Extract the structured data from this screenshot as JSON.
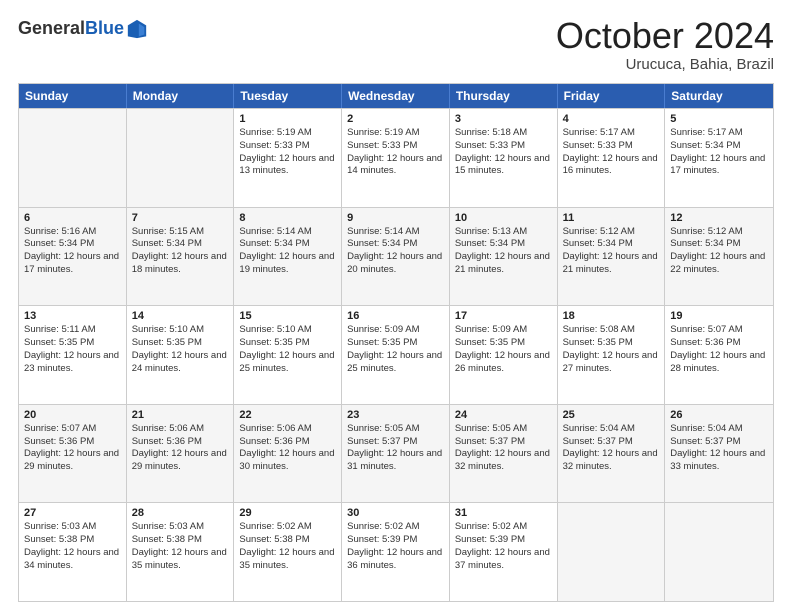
{
  "header": {
    "logo_general": "General",
    "logo_blue": "Blue",
    "month_title": "October 2024",
    "location": "Urucuca, Bahia, Brazil"
  },
  "weekdays": [
    "Sunday",
    "Monday",
    "Tuesday",
    "Wednesday",
    "Thursday",
    "Friday",
    "Saturday"
  ],
  "rows": [
    [
      {
        "day": "",
        "sunrise": "",
        "sunset": "",
        "daylight": "",
        "empty": true
      },
      {
        "day": "",
        "sunrise": "",
        "sunset": "",
        "daylight": "",
        "empty": true
      },
      {
        "day": "1",
        "sunrise": "Sunrise: 5:19 AM",
        "sunset": "Sunset: 5:33 PM",
        "daylight": "Daylight: 12 hours and 13 minutes.",
        "empty": false
      },
      {
        "day": "2",
        "sunrise": "Sunrise: 5:19 AM",
        "sunset": "Sunset: 5:33 PM",
        "daylight": "Daylight: 12 hours and 14 minutes.",
        "empty": false
      },
      {
        "day": "3",
        "sunrise": "Sunrise: 5:18 AM",
        "sunset": "Sunset: 5:33 PM",
        "daylight": "Daylight: 12 hours and 15 minutes.",
        "empty": false
      },
      {
        "day": "4",
        "sunrise": "Sunrise: 5:17 AM",
        "sunset": "Sunset: 5:33 PM",
        "daylight": "Daylight: 12 hours and 16 minutes.",
        "empty": false
      },
      {
        "day": "5",
        "sunrise": "Sunrise: 5:17 AM",
        "sunset": "Sunset: 5:34 PM",
        "daylight": "Daylight: 12 hours and 17 minutes.",
        "empty": false
      }
    ],
    [
      {
        "day": "6",
        "sunrise": "Sunrise: 5:16 AM",
        "sunset": "Sunset: 5:34 PM",
        "daylight": "Daylight: 12 hours and 17 minutes.",
        "empty": false
      },
      {
        "day": "7",
        "sunrise": "Sunrise: 5:15 AM",
        "sunset": "Sunset: 5:34 PM",
        "daylight": "Daylight: 12 hours and 18 minutes.",
        "empty": false
      },
      {
        "day": "8",
        "sunrise": "Sunrise: 5:14 AM",
        "sunset": "Sunset: 5:34 PM",
        "daylight": "Daylight: 12 hours and 19 minutes.",
        "empty": false
      },
      {
        "day": "9",
        "sunrise": "Sunrise: 5:14 AM",
        "sunset": "Sunset: 5:34 PM",
        "daylight": "Daylight: 12 hours and 20 minutes.",
        "empty": false
      },
      {
        "day": "10",
        "sunrise": "Sunrise: 5:13 AM",
        "sunset": "Sunset: 5:34 PM",
        "daylight": "Daylight: 12 hours and 21 minutes.",
        "empty": false
      },
      {
        "day": "11",
        "sunrise": "Sunrise: 5:12 AM",
        "sunset": "Sunset: 5:34 PM",
        "daylight": "Daylight: 12 hours and 21 minutes.",
        "empty": false
      },
      {
        "day": "12",
        "sunrise": "Sunrise: 5:12 AM",
        "sunset": "Sunset: 5:34 PM",
        "daylight": "Daylight: 12 hours and 22 minutes.",
        "empty": false
      }
    ],
    [
      {
        "day": "13",
        "sunrise": "Sunrise: 5:11 AM",
        "sunset": "Sunset: 5:35 PM",
        "daylight": "Daylight: 12 hours and 23 minutes.",
        "empty": false
      },
      {
        "day": "14",
        "sunrise": "Sunrise: 5:10 AM",
        "sunset": "Sunset: 5:35 PM",
        "daylight": "Daylight: 12 hours and 24 minutes.",
        "empty": false
      },
      {
        "day": "15",
        "sunrise": "Sunrise: 5:10 AM",
        "sunset": "Sunset: 5:35 PM",
        "daylight": "Daylight: 12 hours and 25 minutes.",
        "empty": false
      },
      {
        "day": "16",
        "sunrise": "Sunrise: 5:09 AM",
        "sunset": "Sunset: 5:35 PM",
        "daylight": "Daylight: 12 hours and 25 minutes.",
        "empty": false
      },
      {
        "day": "17",
        "sunrise": "Sunrise: 5:09 AM",
        "sunset": "Sunset: 5:35 PM",
        "daylight": "Daylight: 12 hours and 26 minutes.",
        "empty": false
      },
      {
        "day": "18",
        "sunrise": "Sunrise: 5:08 AM",
        "sunset": "Sunset: 5:35 PM",
        "daylight": "Daylight: 12 hours and 27 minutes.",
        "empty": false
      },
      {
        "day": "19",
        "sunrise": "Sunrise: 5:07 AM",
        "sunset": "Sunset: 5:36 PM",
        "daylight": "Daylight: 12 hours and 28 minutes.",
        "empty": false
      }
    ],
    [
      {
        "day": "20",
        "sunrise": "Sunrise: 5:07 AM",
        "sunset": "Sunset: 5:36 PM",
        "daylight": "Daylight: 12 hours and 29 minutes.",
        "empty": false
      },
      {
        "day": "21",
        "sunrise": "Sunrise: 5:06 AM",
        "sunset": "Sunset: 5:36 PM",
        "daylight": "Daylight: 12 hours and 29 minutes.",
        "empty": false
      },
      {
        "day": "22",
        "sunrise": "Sunrise: 5:06 AM",
        "sunset": "Sunset: 5:36 PM",
        "daylight": "Daylight: 12 hours and 30 minutes.",
        "empty": false
      },
      {
        "day": "23",
        "sunrise": "Sunrise: 5:05 AM",
        "sunset": "Sunset: 5:37 PM",
        "daylight": "Daylight: 12 hours and 31 minutes.",
        "empty": false
      },
      {
        "day": "24",
        "sunrise": "Sunrise: 5:05 AM",
        "sunset": "Sunset: 5:37 PM",
        "daylight": "Daylight: 12 hours and 32 minutes.",
        "empty": false
      },
      {
        "day": "25",
        "sunrise": "Sunrise: 5:04 AM",
        "sunset": "Sunset: 5:37 PM",
        "daylight": "Daylight: 12 hours and 32 minutes.",
        "empty": false
      },
      {
        "day": "26",
        "sunrise": "Sunrise: 5:04 AM",
        "sunset": "Sunset: 5:37 PM",
        "daylight": "Daylight: 12 hours and 33 minutes.",
        "empty": false
      }
    ],
    [
      {
        "day": "27",
        "sunrise": "Sunrise: 5:03 AM",
        "sunset": "Sunset: 5:38 PM",
        "daylight": "Daylight: 12 hours and 34 minutes.",
        "empty": false
      },
      {
        "day": "28",
        "sunrise": "Sunrise: 5:03 AM",
        "sunset": "Sunset: 5:38 PM",
        "daylight": "Daylight: 12 hours and 35 minutes.",
        "empty": false
      },
      {
        "day": "29",
        "sunrise": "Sunrise: 5:02 AM",
        "sunset": "Sunset: 5:38 PM",
        "daylight": "Daylight: 12 hours and 35 minutes.",
        "empty": false
      },
      {
        "day": "30",
        "sunrise": "Sunrise: 5:02 AM",
        "sunset": "Sunset: 5:39 PM",
        "daylight": "Daylight: 12 hours and 36 minutes.",
        "empty": false
      },
      {
        "day": "31",
        "sunrise": "Sunrise: 5:02 AM",
        "sunset": "Sunset: 5:39 PM",
        "daylight": "Daylight: 12 hours and 37 minutes.",
        "empty": false
      },
      {
        "day": "",
        "sunrise": "",
        "sunset": "",
        "daylight": "",
        "empty": true
      },
      {
        "day": "",
        "sunrise": "",
        "sunset": "",
        "daylight": "",
        "empty": true
      }
    ]
  ]
}
